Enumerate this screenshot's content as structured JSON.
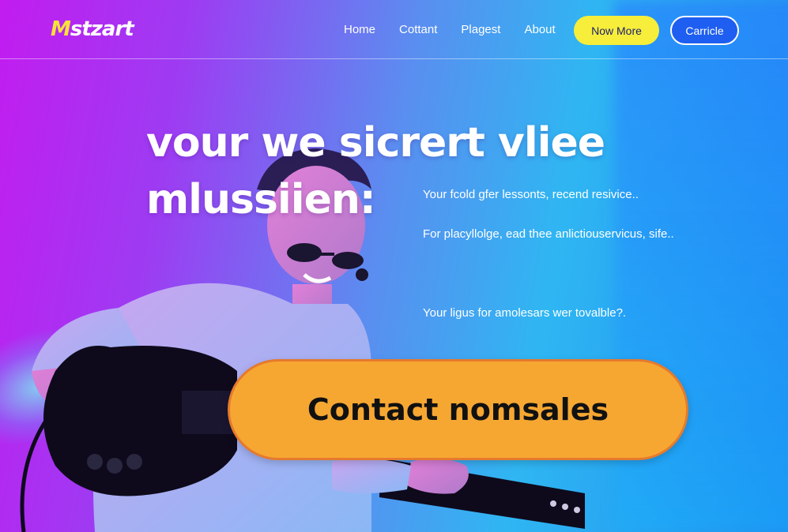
{
  "header": {
    "logo_first": "M",
    "logo_rest": "stzart",
    "nav": [
      "Home",
      "Cottant",
      "Plagest",
      "About"
    ],
    "now_more_label": "Now More",
    "carricle_label": "Carricle"
  },
  "hero": {
    "title_line1": "vour we sicrert vliee",
    "title_line2": "mlussiien:",
    "desc1": "Your fcold gfer lessonts, recend resivice..",
    "desc2": "For placyllolge, ead thee anlictiouservicus, sife..",
    "desc3": "Your ligus for amolesars wer tovalble?."
  },
  "cta": {
    "label": "Contact nomsales"
  },
  "colors": {
    "accent_yellow": "#f7ee3b",
    "cta_orange": "#f6a732",
    "brand_blue": "#1e5ef0"
  },
  "icons": [
    "musician-illustration"
  ]
}
